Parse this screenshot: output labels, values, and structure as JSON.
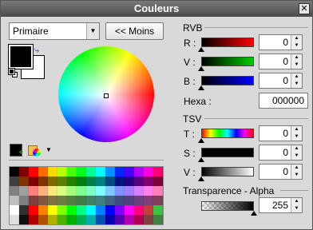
{
  "window": {
    "title": "Couleurs",
    "close_label": "✕"
  },
  "left": {
    "combo_value": "Primaire",
    "combo_arrow": "▼",
    "less_button": "<< Moins",
    "swap_glyph": "⤷",
    "toolbar_arrow": "▼",
    "primary_color": "#000000",
    "secondary_color": "#ffffff",
    "palette_rows": [
      [
        "#000000",
        "#7f0000",
        "#ff0000",
        "#ff6a00",
        "#ffd800",
        "#b6ff00",
        "#4cff00",
        "#00ff21",
        "#00ff90",
        "#00ffff",
        "#0094ff",
        "#0026ff",
        "#4800ff",
        "#b200ff",
        "#ff00dc",
        "#ff006e"
      ],
      [
        "#404040",
        "#7f3300",
        "#7f0000",
        "#7f3300",
        "#7f6a00",
        "#5b7f00",
        "#267f00",
        "#007f0e",
        "#007f46",
        "#007f7f",
        "#004a7f",
        "#00137f",
        "#21007f",
        "#57007f",
        "#7f006e",
        "#7f0037"
      ],
      [
        "#808080",
        "#a0a0a0",
        "#ff7f7f",
        "#ffb27f",
        "#ffe97f",
        "#daff7f",
        "#a5ff7f",
        "#7fff8e",
        "#7fffc5",
        "#7fffff",
        "#7fc9ff",
        "#7f92ff",
        "#a17fff",
        "#d67fff",
        "#ff7fed",
        "#ff7fb6"
      ],
      [
        "#c0c0c0",
        "#7f7f7f",
        "#7f3f3f",
        "#7f593f",
        "#7f743f",
        "#6d7f3f",
        "#527f3f",
        "#3f7f47",
        "#3f7f62",
        "#3f7f7f",
        "#3f647f",
        "#3f497f",
        "#503f7f",
        "#6b3f7f",
        "#7f3f76",
        "#7f3f5b"
      ],
      [
        "#ffffff",
        "#303030",
        "#ff0000",
        "#ff8000",
        "#ffff00",
        "#80ff00",
        "#00ff00",
        "#00ff80",
        "#00ffff",
        "#0080ff",
        "#0000ff",
        "#8000ff",
        "#ff00ff",
        "#ff0080",
        "#c04040",
        "#40c040"
      ],
      [
        "#e0e0e0",
        "#101010",
        "#b00000",
        "#b05000",
        "#b0b000",
        "#50b000",
        "#00b000",
        "#00b050",
        "#00b0b0",
        "#0050b0",
        "#0000b0",
        "#5000b0",
        "#b000b0",
        "#b00050",
        "#804040",
        "#408040"
      ]
    ]
  },
  "right": {
    "rgb_heading": "RVB",
    "r": {
      "label": "R :",
      "value": "0"
    },
    "g": {
      "label": "V :",
      "value": "0"
    },
    "b": {
      "label": "B :",
      "value": "0"
    },
    "hex": {
      "label": "Hexa :",
      "value": "000000"
    },
    "hsv_heading": "TSV",
    "h": {
      "label": "T :",
      "value": "0"
    },
    "s": {
      "label": "S :",
      "value": "0"
    },
    "v": {
      "label": "V :",
      "value": "0"
    },
    "alpha": {
      "label": "Transparence - Alpha",
      "value": "255",
      "level": 1.0
    },
    "spin_up": "▲",
    "spin_down": "▼"
  }
}
